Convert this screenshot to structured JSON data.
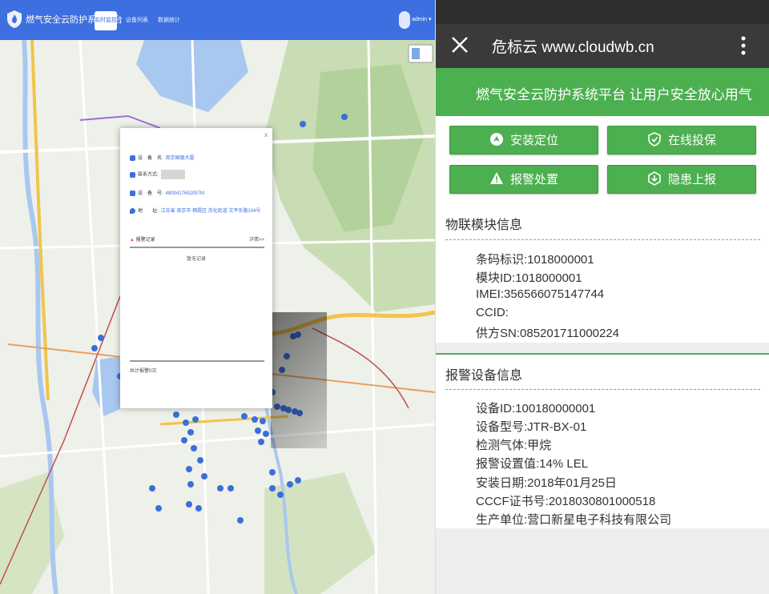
{
  "desktop": {
    "app_title": "燃气安全云防护系统平台",
    "tabs": [
      {
        "label": "实时监控",
        "active": true
      },
      {
        "label": "设备列表",
        "active": false
      },
      {
        "label": "数据统计",
        "active": false
      }
    ],
    "user": "admin ▾",
    "popup": {
      "close": "x",
      "device_label": "设　备　名:",
      "device_value": "南京国银大厦",
      "contact_label": "联系方式:",
      "code_label": "设　备　号:",
      "code_value": "4800417652057M",
      "address_label": "地　　址:",
      "address_value": "江苏省 南京市 栖霞区 尧化街道 文平东路104号",
      "alarm_title": "报警记录",
      "alarm_more": "详情>>",
      "alarm_empty": "暂无记录",
      "alarm_count": "共计报警0次"
    }
  },
  "mobile": {
    "site_title": "危标云 www.cloudwb.cn",
    "banner": "燃气安全云防护系统平台  让用户安全放心用气",
    "buttons": [
      {
        "label": "安装定位",
        "icon": "location-icon"
      },
      {
        "label": "在线投保",
        "icon": "shield-icon"
      },
      {
        "label": "报警处置",
        "icon": "warning-icon"
      },
      {
        "label": "隐患上报",
        "icon": "report-icon"
      }
    ],
    "iot_section": {
      "title": "物联模块信息",
      "fields": [
        "条码标识:1018000001",
        "模块ID:1018000001",
        "IMEI:356566075147744",
        "CCID:",
        "供方SN:085201711000224"
      ]
    },
    "alarm_section": {
      "title": "报警设备信息",
      "fields": [
        "设备ID:100180000001",
        "设备型号:JTR-BX-01",
        "检测气体:甲烷",
        "报警设置值:14% LEL",
        "安装日期:2018年01月25日",
        "CCCF证书号:2018030801000518",
        "生产单位:营口新星电子科技有限公司"
      ]
    }
  },
  "colors": {
    "desktop_header": "#3d6fe0",
    "mobile_green": "#4caf50",
    "mobile_appbar": "#3a3a3a"
  }
}
